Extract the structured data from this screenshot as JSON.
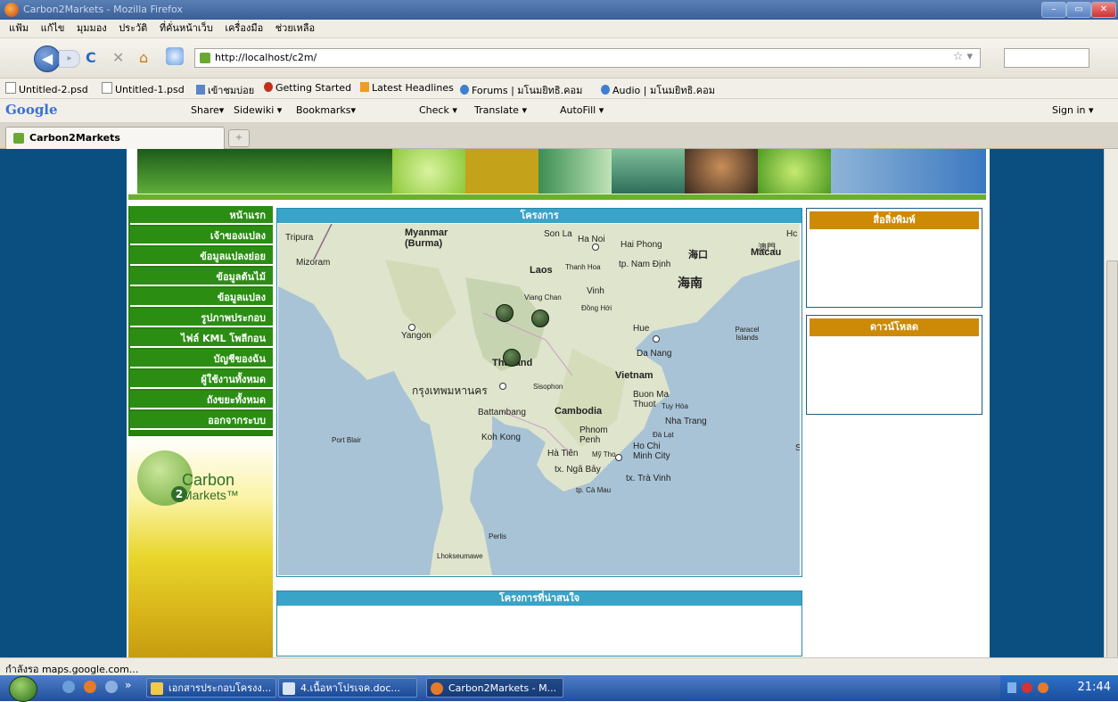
{
  "window": {
    "title": "Carbon2Markets - Mozilla Firefox",
    "btn_min": "–",
    "btn_max": "▭",
    "btn_close": "✕"
  },
  "menubar": [
    "แฟ้ม",
    "แก้ไข",
    "มุมมอง",
    "ประวัติ",
    "ที่คั่นหน้าเว็บ",
    "เครื่องมือ",
    "ช่วยเหลือ"
  ],
  "nav": {
    "url": "http://localhost/c2m/",
    "back_icon": "◀",
    "forward_icon": "▸",
    "reload_icon": "C",
    "stop_icon": "✕",
    "home_icon": "⌂"
  },
  "bookmarks": [
    "Untitled-2.psd",
    "Untitled-1.psd",
    "เข้าชมบ่อย",
    "Getting Started",
    "Latest Headlines",
    "Forums | มโนมยิทธิ.คอม",
    "Audio | มโนมยิทธิ.คอม"
  ],
  "gtoolbar": {
    "logo": "Google",
    "share": "Share▾",
    "sidewiki": "Sidewiki ▾",
    "bookmarks": "Bookmarks▾",
    "check": "Check ▾",
    "translate": "Translate ▾",
    "autofill": "AutoFill ▾",
    "signin": "Sign in ▾"
  },
  "tabs": [
    {
      "label": "Carbon2Markets"
    }
  ],
  "newtab": "+",
  "site": {
    "menu": [
      "หน้าแรก",
      "เจ้าของแปลง",
      "ข้อมูลแปลงย่อย",
      "ข้อมูลต้นไม้",
      "ข้อมูลแปลง",
      "รูปภาพประกอบ",
      "ไฟล์ KML โพลีกอน",
      "บัญชีของฉัน",
      "ผู้ใช้งานทั้งหมด",
      "ถังขยะทั้งหมด",
      "ออกจากระบบ"
    ],
    "logo_c2m": "Carbon",
    "logo_markets": "Markets™",
    "logo_digit": "2",
    "projects_title": "โครงการ",
    "interesting_title": "โครงการที่น่าสนใจ",
    "print_media_title": "สื่อสิ่งพิมพ์",
    "download_title": "ดาวน์โหลด"
  },
  "map_labels": {
    "tripura": "Tripura",
    "myanmar": "Myanmar",
    "burma": "(Burma)",
    "mizoram": "Mizoram",
    "sonla": "Son La",
    "hanoi": "Ha Noi",
    "haiphong": "Hai Phong",
    "laos": "Laos",
    "thanhhoa": "Thanh Hoa",
    "namdinh": "tp. Nam Định",
    "vinh": "Vinh",
    "vientiane": "Viang Chan",
    "donghoi": "Đồng Hới",
    "hue": "Hue",
    "paracel": "Paracel Islands",
    "yangon": "Yangon",
    "danang": "Da Nang",
    "thailand": "Thailand",
    "bangkok": "กรุงเทพมหานคร",
    "sisophon": "Sisophon",
    "vietnam": "Vietnam",
    "buonma": "Buon Ma Thuot",
    "battambang": "Battambang",
    "cambodia": "Cambodia",
    "tuyhoa": "Tuy Hòa",
    "nhatrang": "Nha Trang",
    "kohkong": "Koh Kong",
    "phnompenh": "Phnom Penh",
    "dalat": "Đà Lạt",
    "portblair": "Port Blair",
    "hatien": "Hà Tiên",
    "mytho": "Mỹ Tho",
    "hochiminh": "Ho Chi Minh City",
    "ngabay": "tx. Ngã Bảy",
    "travinh": "tx. Trà Vinh",
    "camau": "tp. Cà Mau",
    "perlis": "Perlis",
    "lhokseumawe": "Lhokseumawe",
    "macau": "Macau",
    "hainan": "海南",
    "macau_cn": "澳門",
    "haikou": "海口",
    "hc": "Hc",
    "sc": "S"
  },
  "status": "กำลังรอ maps.google.com...",
  "taskbar": {
    "tasks": [
      "เอกสารประกอบโครงง...",
      "4.เนื้อหาโปรเจค.doc...",
      "Carbon2Markets - M..."
    ],
    "clock": "21:44",
    "chevron": "»"
  }
}
